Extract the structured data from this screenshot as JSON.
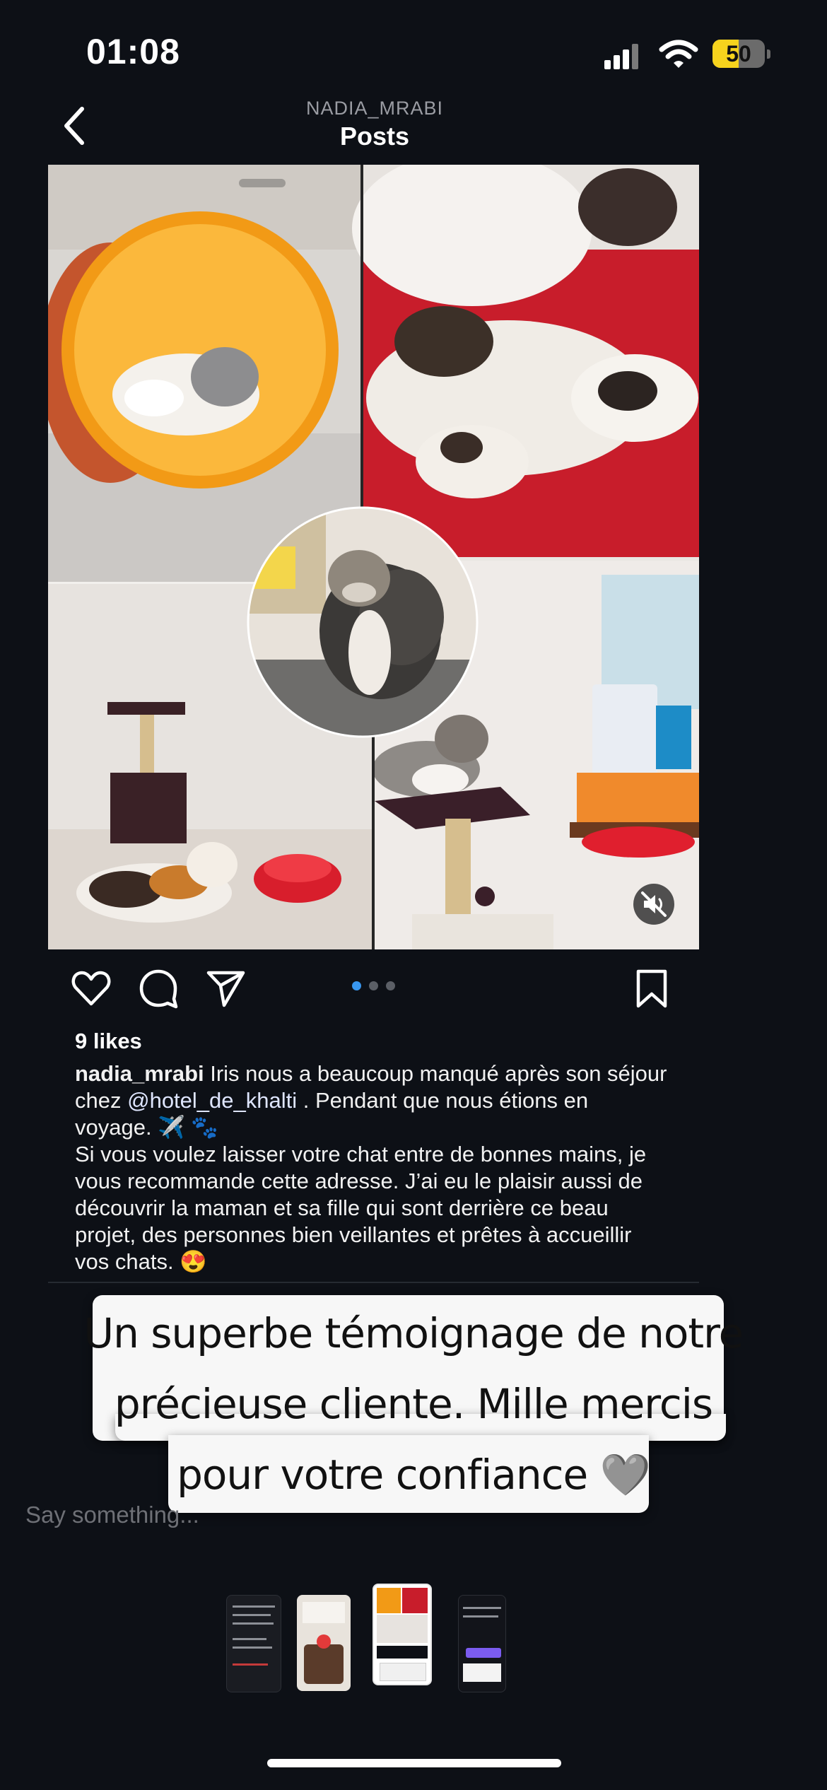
{
  "status_bar": {
    "time": "01:08",
    "battery": "50",
    "battery_level": 0.5
  },
  "header": {
    "username": "NADIA_MRABI",
    "title": "Posts"
  },
  "post": {
    "carousel": {
      "count": 3,
      "active_index": 0
    },
    "likes": "9 likes",
    "caption": {
      "username": "nadia_mrabi",
      "part1": " Iris nous a beaucoup manqué après son séjour chez ",
      "mention": "@hotel_de_khalti",
      "part2": " . Pendant que nous étions en voyage. ✈️ 🐾",
      "paragraph2": "Si vous voulez laisser votre chat entre de bonnes mains, je vous recommande cette adresse. J’ai eu le plaisir aussi de découvrir la maman et sa fille qui sont derrière ce beau projet, des personnes bien veillantes et prêtes à accueillir vos chats. 😍"
    }
  },
  "overlay_text": {
    "line1": "Un superbe témoignage de notre",
    "line2": "précieuse cliente. Mille mercis",
    "line3": "pour votre confiance 🩶"
  },
  "reply": {
    "placeholder": "Say something..."
  },
  "icons": {
    "back": "chevron-left-icon",
    "like": "heart-icon",
    "comment": "comment-icon",
    "share": "send-icon",
    "save": "bookmark-icon",
    "mute": "speaker-muted-icon"
  },
  "colors": {
    "background": "#0d1016",
    "active_dot": "#3897f0",
    "battery": "#f6d31d"
  }
}
